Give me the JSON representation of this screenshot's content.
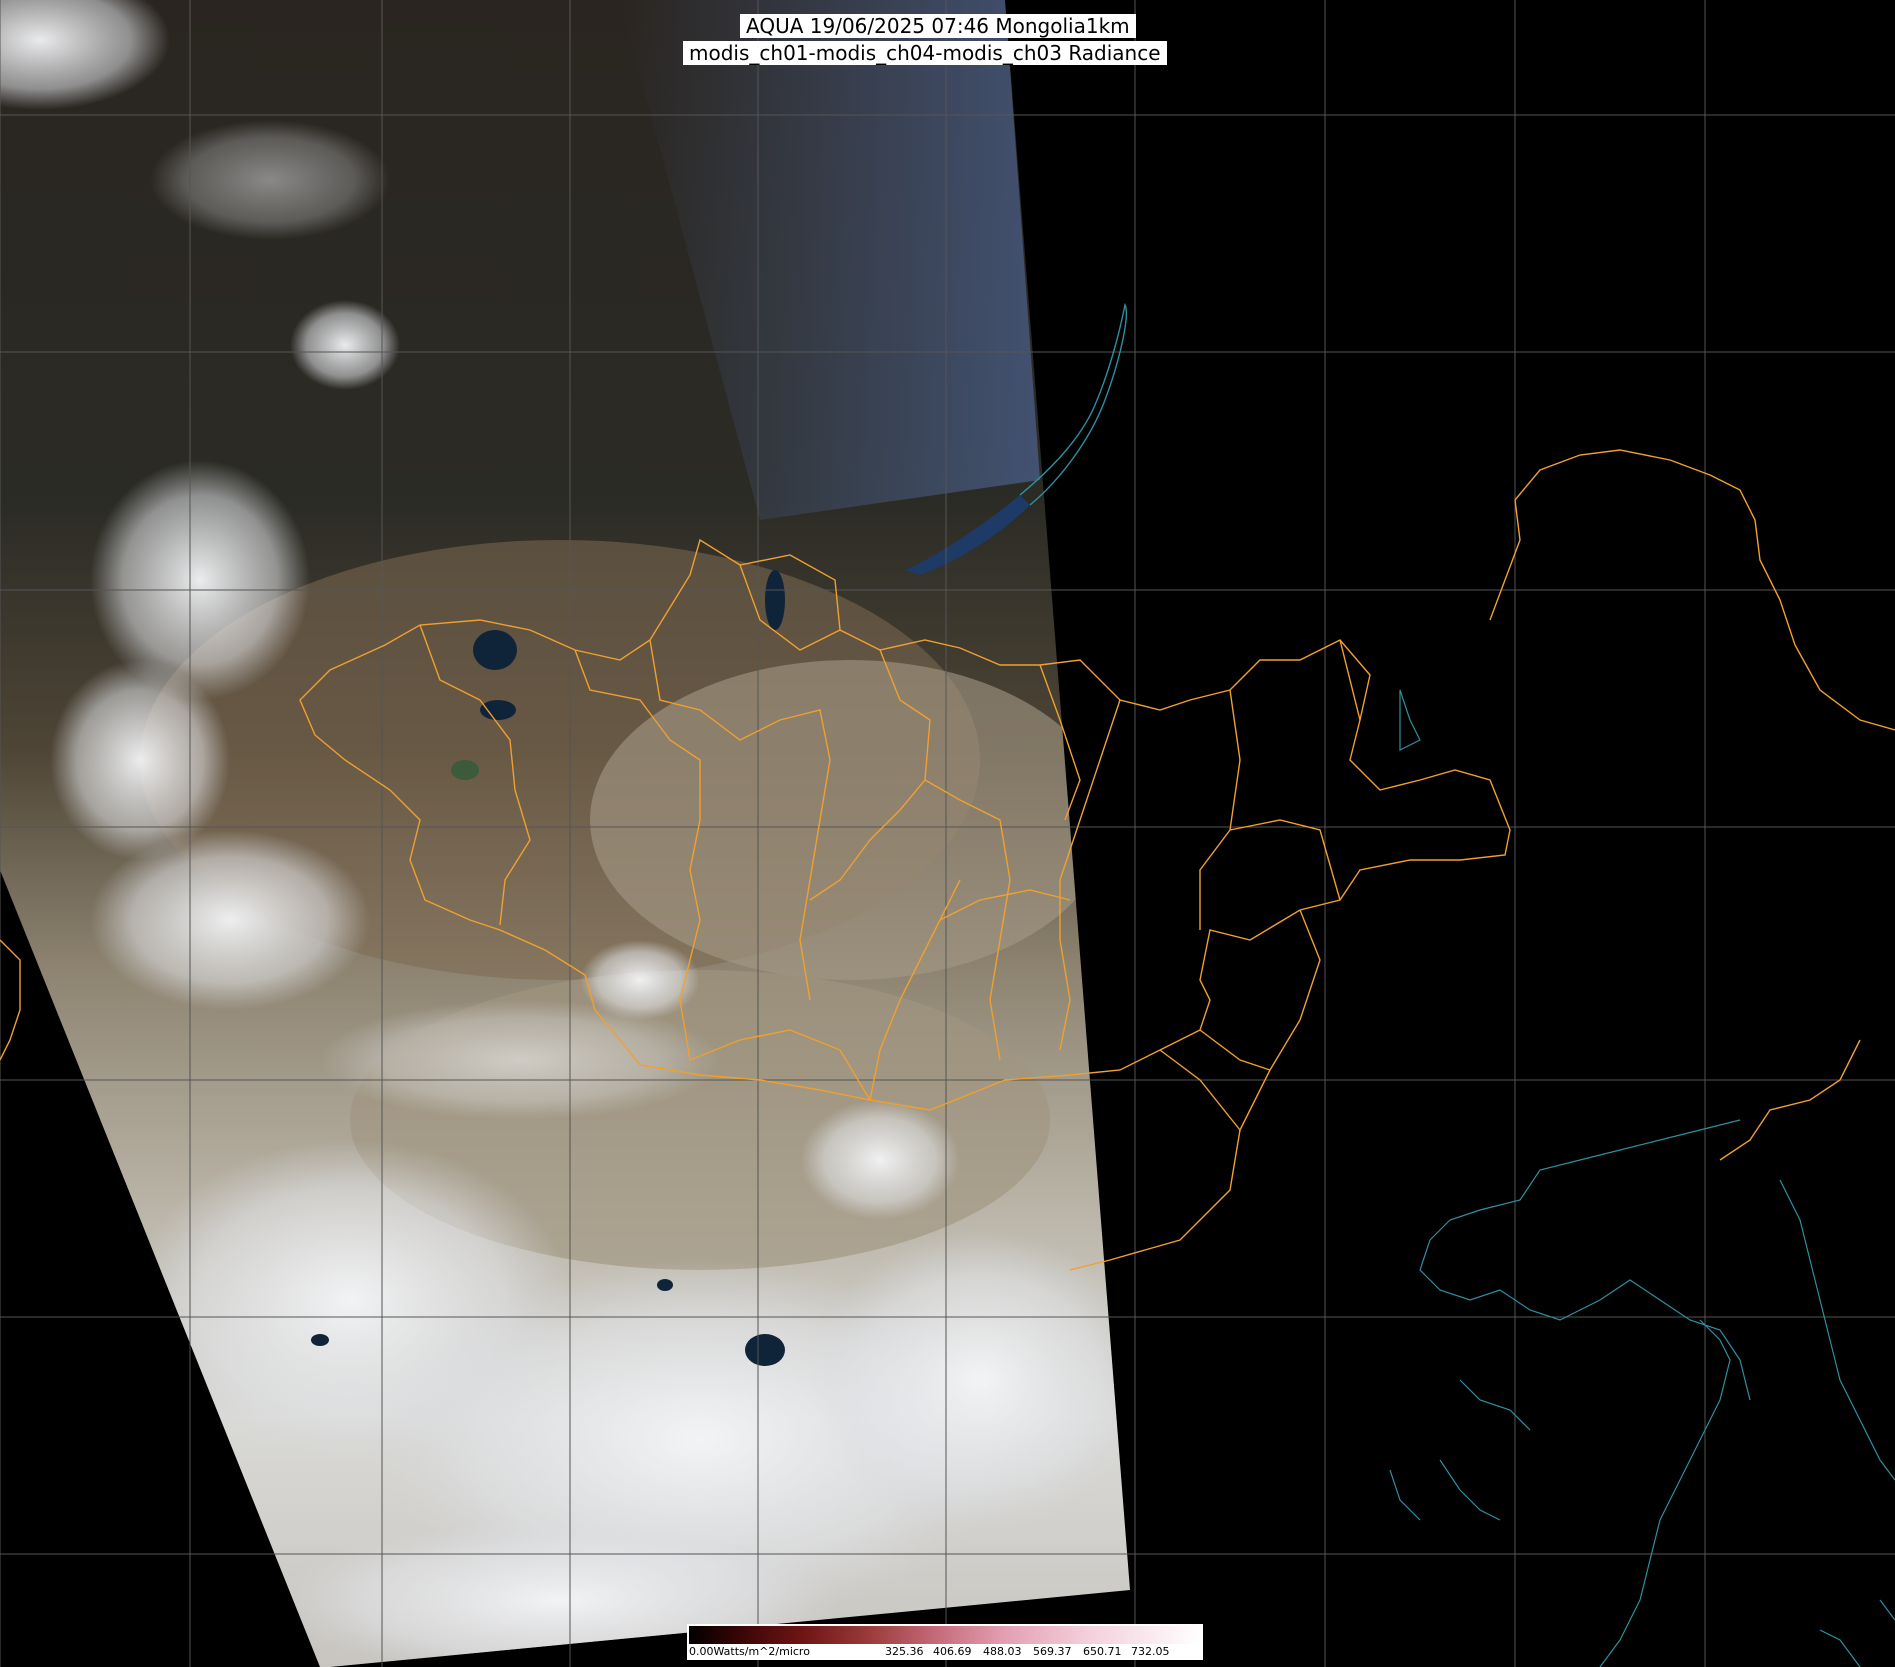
{
  "title": {
    "line1": "AQUA 19/06/2025 07:46 Mongolia1km",
    "line2": "modis_ch01-modis_ch04-modis_ch03 Radiance"
  },
  "colorbar": {
    "labels": [
      "0.00Watts/m^2/micro",
      "325.36",
      "406.69",
      "488.03",
      "569.37",
      "650.71",
      "732.05"
    ]
  },
  "map": {
    "background_color": "#000000",
    "graticule_color": "#555555",
    "admin_boundary_color": "#f0a030",
    "coastline_color": "#2f8fa0",
    "swath_colors": {
      "forest_north": "#2c2a24",
      "sky_blue_edge": "#4a5f8a",
      "desert": "#9a8e78",
      "cloud": "#e8eaee",
      "water": "#122a40"
    }
  }
}
